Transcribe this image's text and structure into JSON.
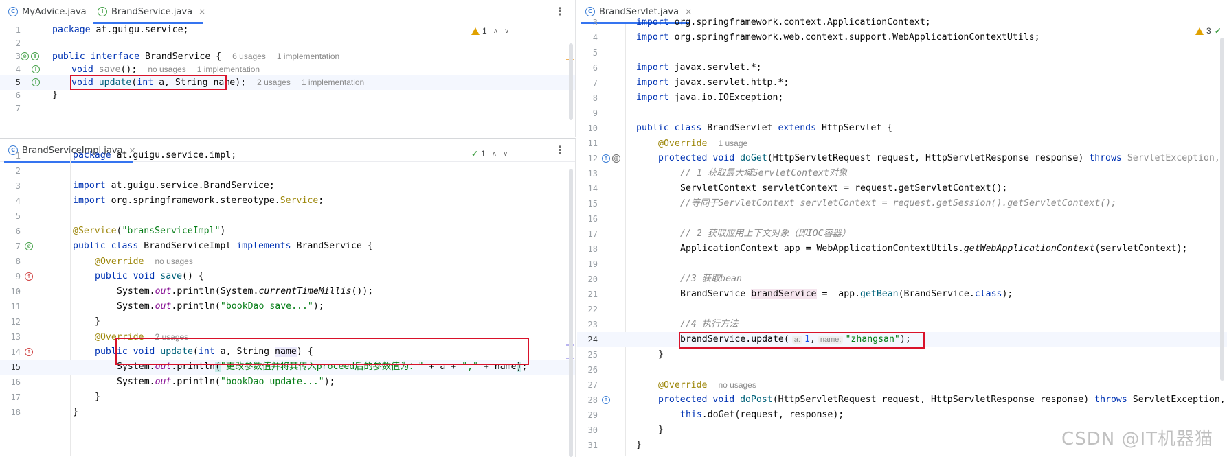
{
  "top_left": {
    "tabs": [
      {
        "label": "MyAdvice.java",
        "icon": "class-icon",
        "active": false
      },
      {
        "label": "BrandService.java",
        "icon": "interface-icon",
        "active": true,
        "close": "×"
      }
    ],
    "inspection": {
      "count": "1",
      "up": "∧",
      "down": "∨"
    },
    "lines": [
      {
        "n": "1"
      },
      {
        "n": "2"
      },
      {
        "n": "3"
      },
      {
        "n": "4"
      },
      {
        "n": "5"
      },
      {
        "n": "6"
      },
      {
        "n": "7"
      }
    ],
    "code": {
      "l1_kw": "package",
      "l1_rest": " at.guigu.service;",
      "l3_kw": "public interface",
      "l3_rest": " BrandService {",
      "l3_hint1": "6 usages",
      "l3_hint2": "1 implementation",
      "l4_kw": "void",
      "l4_method": "save",
      "l4_rest": "();",
      "l4_hint1": "no usages",
      "l4_hint2": "1 implementation",
      "l5_kw": "void",
      "l5_method": "update",
      "l5_rest_a": "(",
      "l5_kw2": "int",
      "l5_rest_b": " a, String name);",
      "l5_hint1": "2 usages",
      "l5_hint2": "1 implementation",
      "l6": "}"
    }
  },
  "bottom_left": {
    "tabs": [
      {
        "label": "BrandServiceImpl.java",
        "icon": "class-icon",
        "active": true,
        "close": "×"
      }
    ],
    "inspection": {
      "count": "1",
      "up": "∧",
      "down": "∨"
    },
    "lines": [
      {
        "n": "1"
      },
      {
        "n": "2"
      },
      {
        "n": "3"
      },
      {
        "n": "4"
      },
      {
        "n": "5"
      },
      {
        "n": "6"
      },
      {
        "n": "7"
      },
      {
        "n": "8"
      },
      {
        "n": "9"
      },
      {
        "n": "10"
      },
      {
        "n": "11"
      },
      {
        "n": "12"
      },
      {
        "n": "13"
      },
      {
        "n": "14"
      },
      {
        "n": "15"
      },
      {
        "n": "16"
      },
      {
        "n": "17"
      },
      {
        "n": "18"
      }
    ],
    "code": {
      "l1_kw": "package",
      "l1_rest": " at.guigu.service.impl;",
      "l3_kw": "import",
      "l3_rest": " at.guigu.service.BrandService;",
      "l4_kw": "import",
      "l4_rest": " org.springframework.stereotype.",
      "l4_ann": "Service",
      "l4_end": ";",
      "l6_ann": "@Service",
      "l6_p1": "(",
      "l6_str": "\"bransServiceImpl\"",
      "l6_p2": ")",
      "l7_kw": "public class",
      "l7_mid": " BrandServiceImpl ",
      "l7_kw2": "implements",
      "l7_rest": " BrandService {",
      "l8_ann": "@Override",
      "l8_hint": "no usages",
      "l9_kw": "public void",
      "l9_method": " save",
      "l9_rest": "() {",
      "l10_a": "System.",
      "l10_f": "out",
      "l10_b": ".println(System.",
      "l10_i": "currentTimeMillis",
      "l10_c": "());",
      "l11_a": "System.",
      "l11_f": "out",
      "l11_b": ".println(",
      "l11_str": "\"bookDao save...\"",
      "l11_c": ");",
      "l12": "}",
      "l13_ann": "@Override",
      "l13_hint": "2 usages",
      "l14_kw": "public void",
      "l14_method": " update",
      "l14_a": "(",
      "l14_kw2": "int",
      "l14_b": " a, String ",
      "l14_var": "name",
      "l14_c": ") {",
      "l15_a": "System.",
      "l15_f": "out",
      "l15_b": ".println",
      "l15_paren": "(",
      "l15_str1": "\"更改参数值并将其传入proceed后的参数值为：\"",
      "l15_c": " + a + ",
      "l15_str2": "\",\"",
      "l15_d": " + name",
      "l15_paren2": ")",
      "l15_e": ";",
      "l16_a": "System.",
      "l16_f": "out",
      "l16_b": ".println(",
      "l16_str": "\"bookDao update...\"",
      "l16_c": ");",
      "l17": "}",
      "l18": "}"
    }
  },
  "right": {
    "tabs": [
      {
        "label": "BrandServlet.java",
        "icon": "class-icon",
        "active": true,
        "close": "×"
      }
    ],
    "inspection": {
      "count": "3"
    },
    "lines": [
      {
        "n": "3"
      },
      {
        "n": "4"
      },
      {
        "n": "5"
      },
      {
        "n": "6"
      },
      {
        "n": "7"
      },
      {
        "n": "8"
      },
      {
        "n": "9"
      },
      {
        "n": "10"
      },
      {
        "n": "11"
      },
      {
        "n": "12"
      },
      {
        "n": "13"
      },
      {
        "n": "14"
      },
      {
        "n": "15"
      },
      {
        "n": "16"
      },
      {
        "n": "17"
      },
      {
        "n": "18"
      },
      {
        "n": "19"
      },
      {
        "n": "20"
      },
      {
        "n": "21"
      },
      {
        "n": "22"
      },
      {
        "n": "23"
      },
      {
        "n": "24"
      },
      {
        "n": "25"
      },
      {
        "n": "26"
      },
      {
        "n": "27"
      },
      {
        "n": "28"
      },
      {
        "n": "29"
      },
      {
        "n": "30"
      },
      {
        "n": "31"
      }
    ],
    "code": {
      "l3_kw": "import",
      "l3_rest": " org.springframework.context.ApplicationContext;",
      "l4_kw": "import",
      "l4_rest": " org.springframework.web.context.support.WebApplicationContextUtils;",
      "l6_kw": "import",
      "l6_rest": " javax.servlet.*;",
      "l7_kw": "import",
      "l7_rest": " javax.servlet.http.*;",
      "l8_kw": "import",
      "l8_rest": " java.io.IOException;",
      "l10_kw": "public class",
      "l10_mid": " BrandServlet ",
      "l10_kw2": "extends",
      "l10_rest": " HttpServlet {",
      "l11_ann": "@Override",
      "l11_hint": "1 usage",
      "l12_kw": "protected void",
      "l12_method": " doGet",
      "l12_rest": "(HttpServletRequest request, HttpServletResponse response) ",
      "l12_kw2": "throws",
      "l12_gray": " ServletException,",
      "l13_c": "// 1 获取最大域ServletContext对象",
      "l14": "ServletContext servletContext = request.getServletContext();",
      "l15_c": "//等同于ServletContext servletContext = request.getSession().getServletContext();",
      "l17_c": "// 2 获取应用上下文对象（即IOC容器）",
      "l18_a": "ApplicationContext app = WebApplicationContextUtils.",
      "l18_i": "getWebApplicationContext",
      "l18_b": "(servletContext);",
      "l20_c": "//3 获取bean",
      "l21_a": "BrandService ",
      "l21_var": "brandService",
      "l21_b": " =  app.",
      "l21_m": "getBean",
      "l21_c": "(BrandService.",
      "l21_kw": "class",
      "l21_d": ");",
      "l23_c": "//4 执行方法",
      "l24_a": "brandService.update(",
      "l24_inlay1": "a:",
      "l24_num": "1",
      "l24_sep": ",",
      "l24_inlay2": "name:",
      "l24_str": "\"zhangsan\"",
      "l24_b": ");",
      "l25": "}",
      "l27_ann": "@Override",
      "l27_hint": "no usages",
      "l28_kw": "protected void",
      "l28_method": " doPost",
      "l28_rest": "(HttpServletRequest request, HttpServletResponse response) ",
      "l28_kw2": "throws",
      "l28_end": " ServletException,",
      "l29_kw": "this",
      "l29_rest": ".doGet(request, response);",
      "l30": "}",
      "l31": "}"
    }
  },
  "watermark": "CSDN @IT机器猫",
  "colors": {
    "accent": "#3574f0",
    "highlight_box": "#d9122a",
    "keyword": "#0033b3",
    "string": "#067d17",
    "annotation": "#9e880d"
  }
}
